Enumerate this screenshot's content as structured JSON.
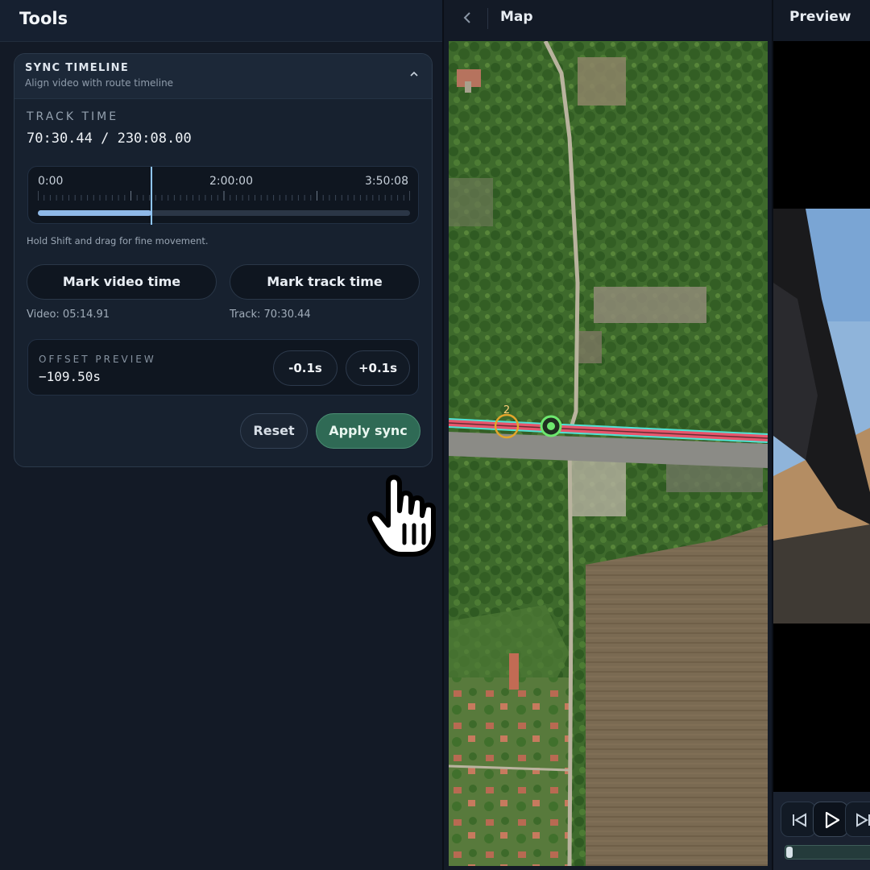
{
  "tools": {
    "title": "Tools",
    "sync_card": {
      "title": "SYNC TIMELINE",
      "subtitle": "Align video with route timeline",
      "track_time_label": "TRACK TIME",
      "track_time_value": "70:30.44 / 230:08.00",
      "scrubber": {
        "tick_start": "0:00",
        "tick_mid": "2:00:00",
        "tick_end": "3:50:08",
        "progress_fraction": 0.306
      },
      "hint": "Hold Shift and drag for fine movement.",
      "mark_video_label": "Mark video time",
      "mark_track_label": "Mark track time",
      "video_time": "Video: 05:14.91",
      "track_time": "Track: 70:30.44",
      "offset_label": "OFFSET PREVIEW",
      "offset_value": "−109.50s",
      "minus_label": "-0.1s",
      "plus_label": "+0.1s",
      "reset_label": "Reset",
      "apply_label": "Apply sync"
    }
  },
  "map": {
    "title": "Map",
    "marker_label": "2"
  },
  "preview": {
    "title": "Preview"
  },
  "colors": {
    "accent_green": "#2f6a55",
    "route_red": "#e8556b",
    "route_cyan": "#4fe3d6",
    "marker_orange": "#e3a52b",
    "marker_green": "#6ee86e"
  }
}
